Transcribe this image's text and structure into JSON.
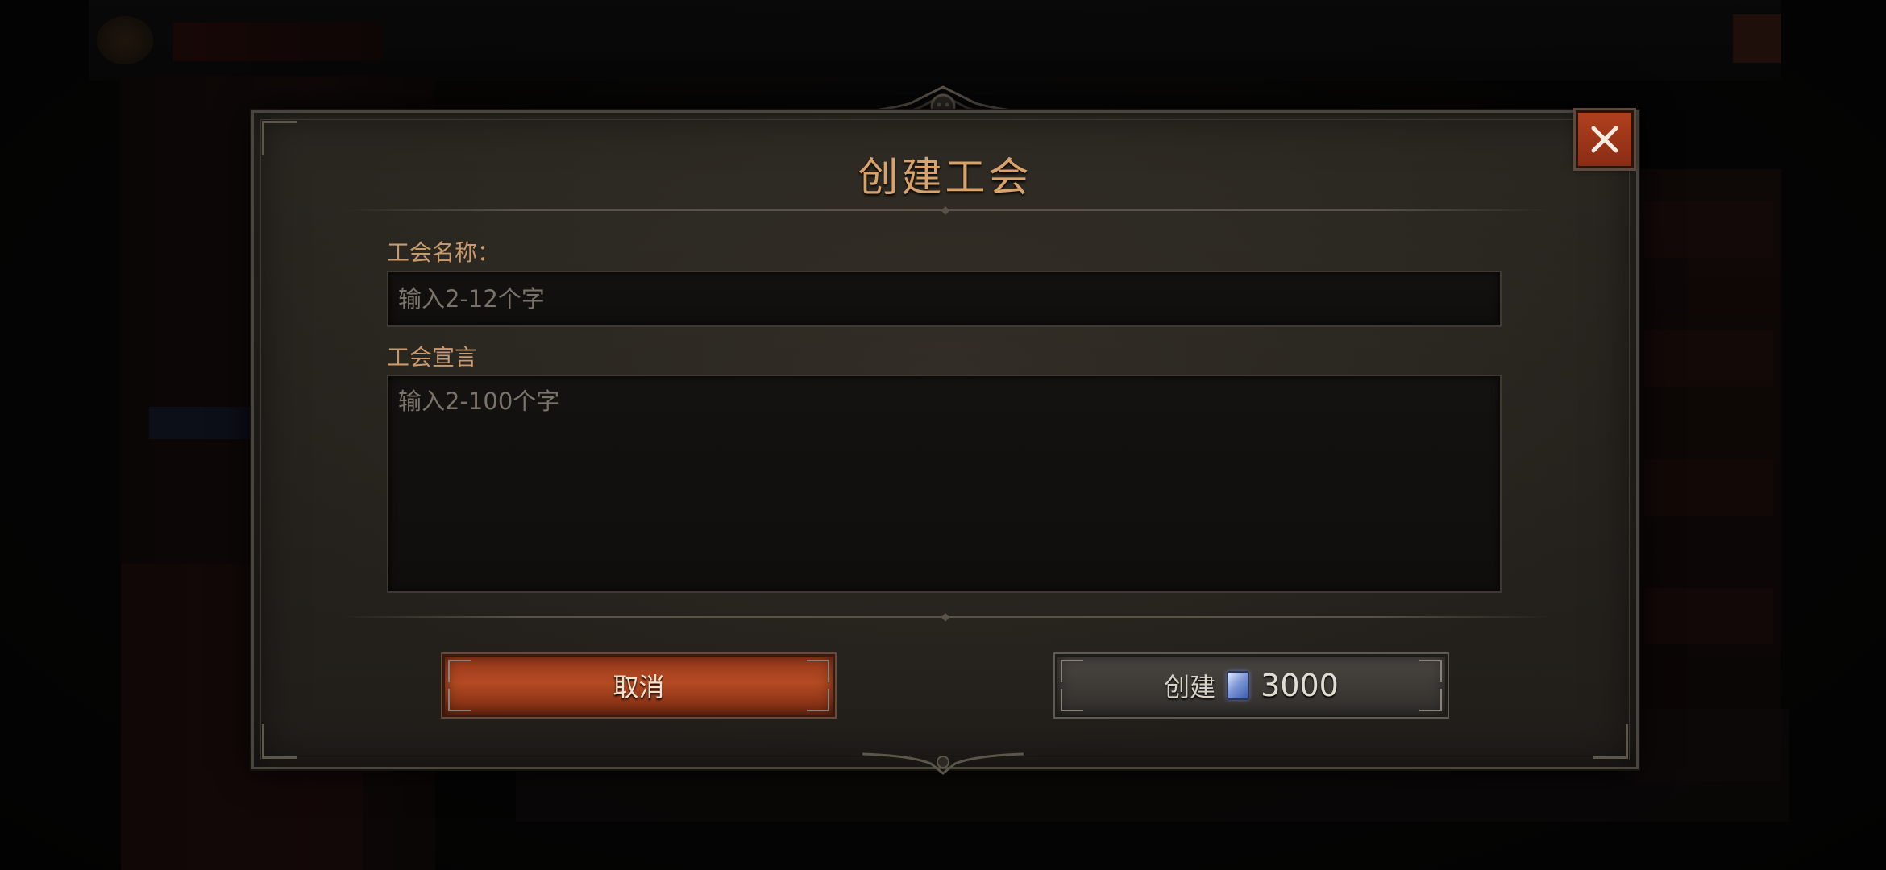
{
  "dialog": {
    "title": "创建工会",
    "close_icon": "close-icon"
  },
  "form": {
    "name_label": "工会名称：",
    "name_placeholder": "输入2-12个字",
    "name_value": "",
    "manifesto_label": "工会宣言",
    "manifesto_placeholder": "输入2-100个字",
    "manifesto_value": ""
  },
  "buttons": {
    "cancel_label": "取消",
    "create_label": "创建",
    "create_cost_icon": "gem-icon",
    "create_cost": "3000"
  },
  "colors": {
    "title": "#d8a36a",
    "label": "#c99a6b",
    "cancel_button": "#b34a22",
    "create_button": "#3e3b37"
  }
}
